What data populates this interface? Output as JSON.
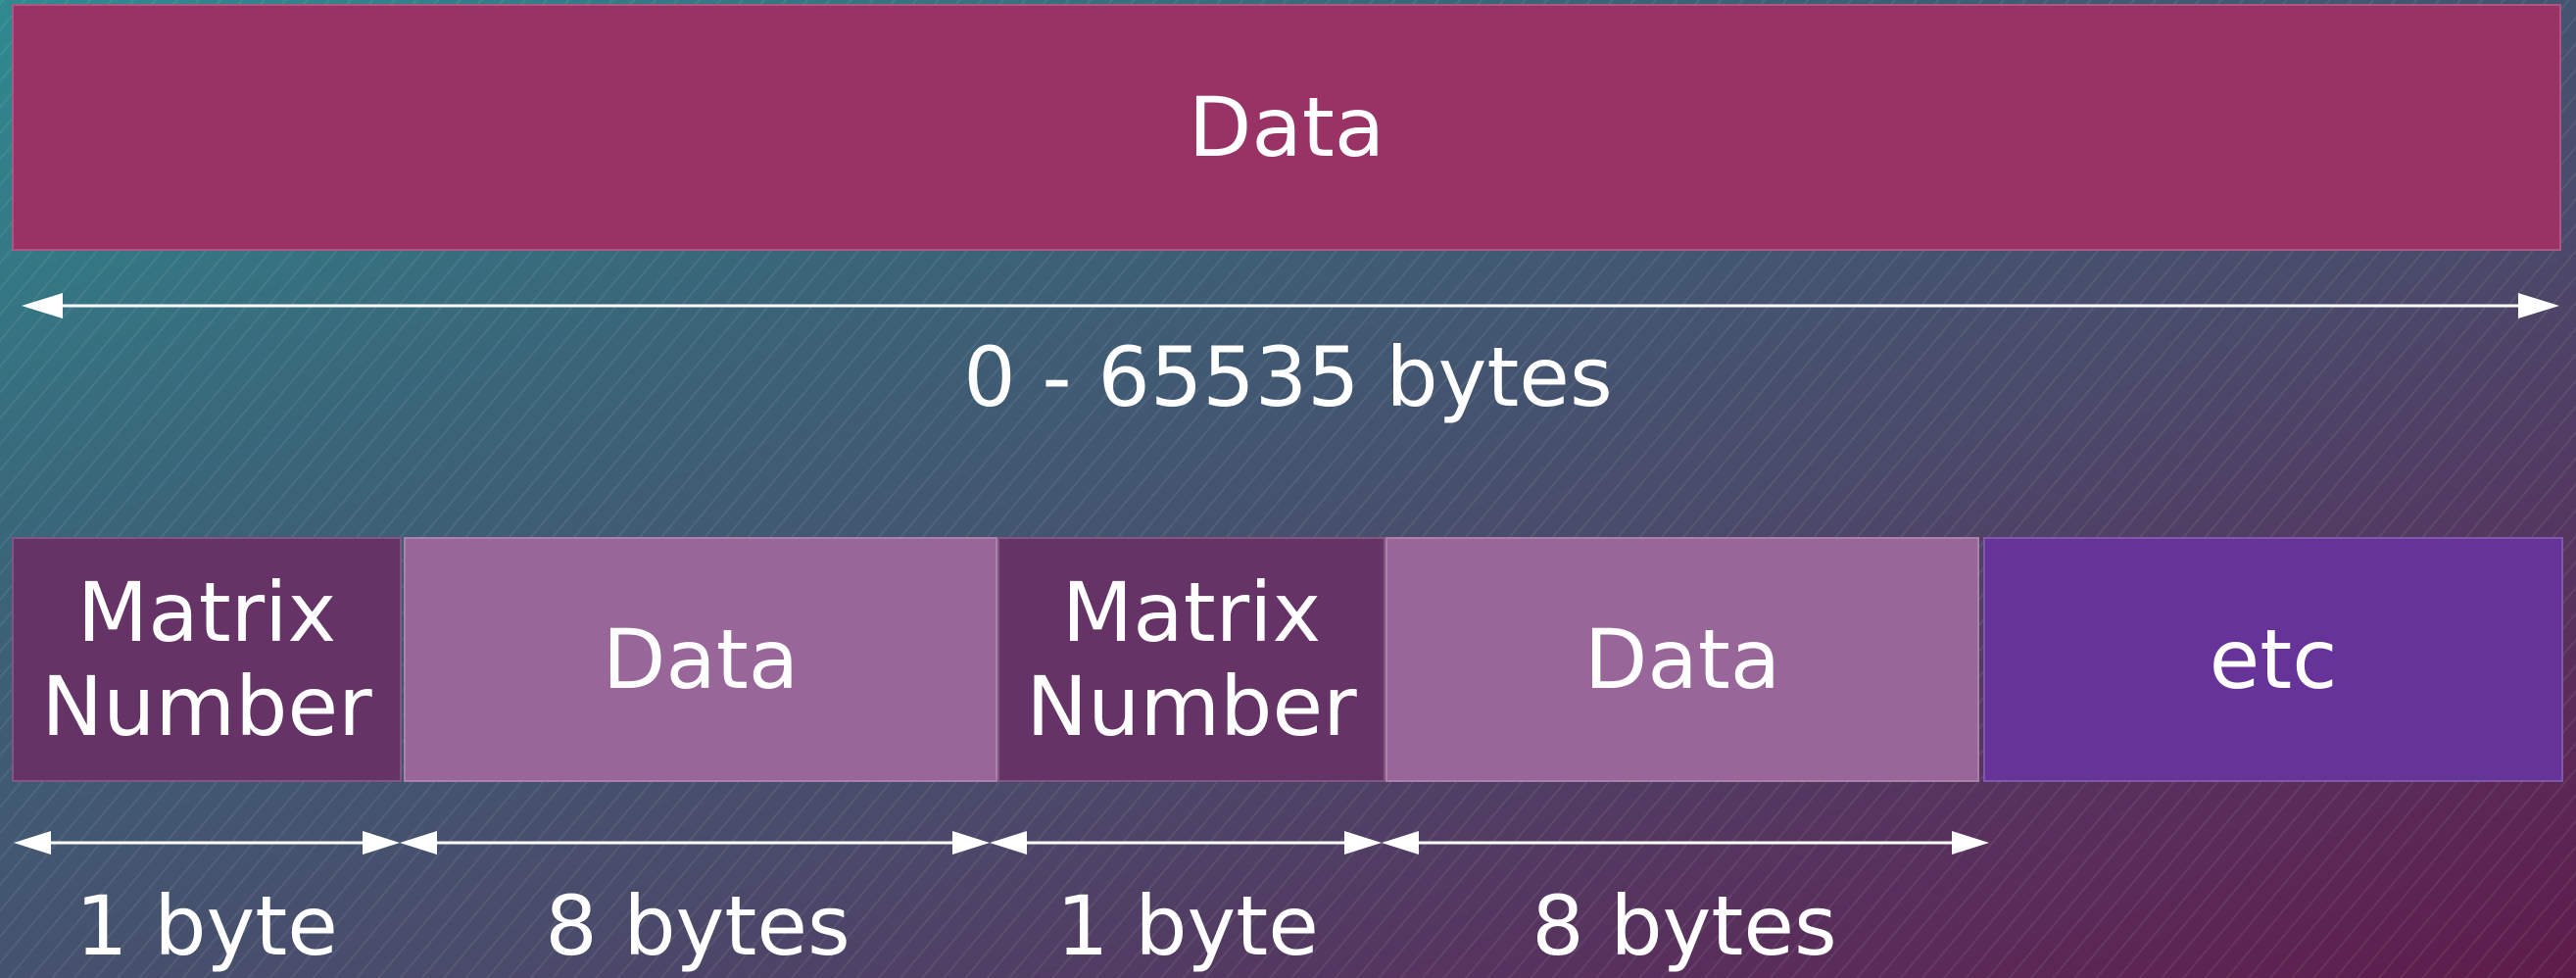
{
  "top_block": {
    "label": "Data",
    "color": "#993366"
  },
  "total_size_label": "0 - 65535 bytes",
  "segments": [
    {
      "label_line1": "Matrix",
      "label_line2": "Number",
      "color": "#663366"
    },
    {
      "label": "Data",
      "color": "#996699"
    },
    {
      "label_line1": "Matrix",
      "label_line2": "Number",
      "color": "#663366"
    },
    {
      "label": "Data",
      "color": "#996699"
    },
    {
      "label": "etc",
      "color": "#663399"
    }
  ],
  "segment_sizes": [
    "1 byte",
    "8 bytes",
    "1 byte",
    "8 bytes"
  ],
  "arrow_color": "#ffffff"
}
